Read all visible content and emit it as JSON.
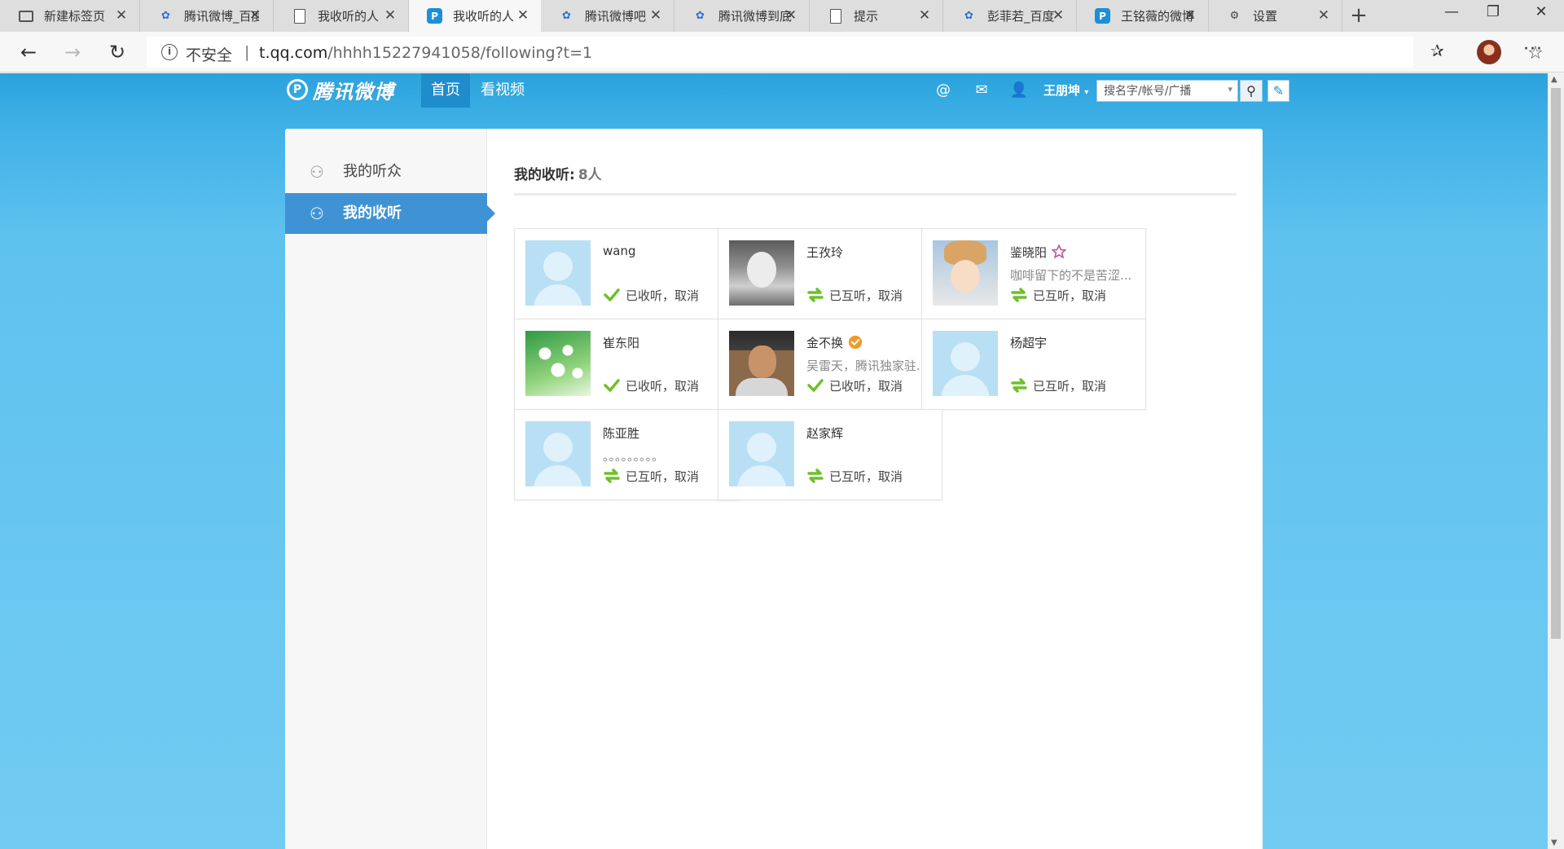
{
  "browser": {
    "tabs": [
      {
        "label": "新建标签页",
        "icon": "new-tab-icon"
      },
      {
        "label": "腾讯微博_百度百科",
        "icon": "baidu-paw-icon"
      },
      {
        "label": "我收听的人",
        "icon": "page-icon"
      },
      {
        "label": "我收听的人",
        "icon": "weibo-icon",
        "active": true
      },
      {
        "label": "腾讯微博吧",
        "icon": "baidu-paw-icon"
      },
      {
        "label": "腾讯微博到底",
        "icon": "baidu-paw-icon"
      },
      {
        "label": "提示",
        "icon": "page-icon"
      },
      {
        "label": "彭菲若_百度",
        "icon": "baidu-paw-icon"
      },
      {
        "label": "王铭薇的微博",
        "icon": "weibo-icon"
      },
      {
        "label": "设置",
        "icon": "gear-icon"
      }
    ],
    "security_label": "不安全",
    "url_host": "t.qq.com",
    "url_path": "/hhhh15227941058/following?t=1"
  },
  "site": {
    "logo_text": "腾讯微博",
    "nav": [
      {
        "label": "首页",
        "active": true
      },
      {
        "label": "看视频",
        "active": false
      }
    ],
    "username": "王朋坤",
    "search_placeholder": "搜名字/帐号/广播"
  },
  "sidebar": {
    "items": [
      {
        "label": "我的听众",
        "active": false
      },
      {
        "label": "我的收听",
        "active": true
      }
    ]
  },
  "content": {
    "title": "我的收听:",
    "count": "8人",
    "status_labels": {
      "following": "已收听",
      "mutual": "已互听",
      "separator": "，",
      "cancel": "取消"
    },
    "users": [
      {
        "name": "wang",
        "bio": "",
        "status": "following",
        "avatar": "default",
        "badge": ""
      },
      {
        "name": "王孜玲",
        "bio": "",
        "status": "mutual",
        "avatar": "girl",
        "badge": ""
      },
      {
        "name": "鉴晓阳",
        "bio": "咖啡留下的不是苦涩...",
        "status": "mutual",
        "avatar": "boy",
        "badge": "star"
      },
      {
        "name": "崔东阳",
        "bio": "",
        "status": "following",
        "avatar": "flower",
        "badge": ""
      },
      {
        "name": "金不换",
        "bio": "吴雷天，腾讯独家驻...",
        "status": "following",
        "avatar": "man",
        "badge": "verified"
      },
      {
        "name": "杨超宇",
        "bio": "",
        "status": "mutual",
        "avatar": "default",
        "badge": ""
      },
      {
        "name": "陈亚胜",
        "bio": "。。。。。。。。。",
        "status": "mutual",
        "avatar": "default",
        "badge": ""
      },
      {
        "name": "赵家辉",
        "bio": "",
        "status": "mutual",
        "avatar": "default",
        "badge": ""
      }
    ]
  },
  "colors": {
    "accent": "#3f93d4",
    "header_blue": "#2aa2dc",
    "check_green": "#6fbf2b",
    "verified_orange": "#f19a2b"
  }
}
